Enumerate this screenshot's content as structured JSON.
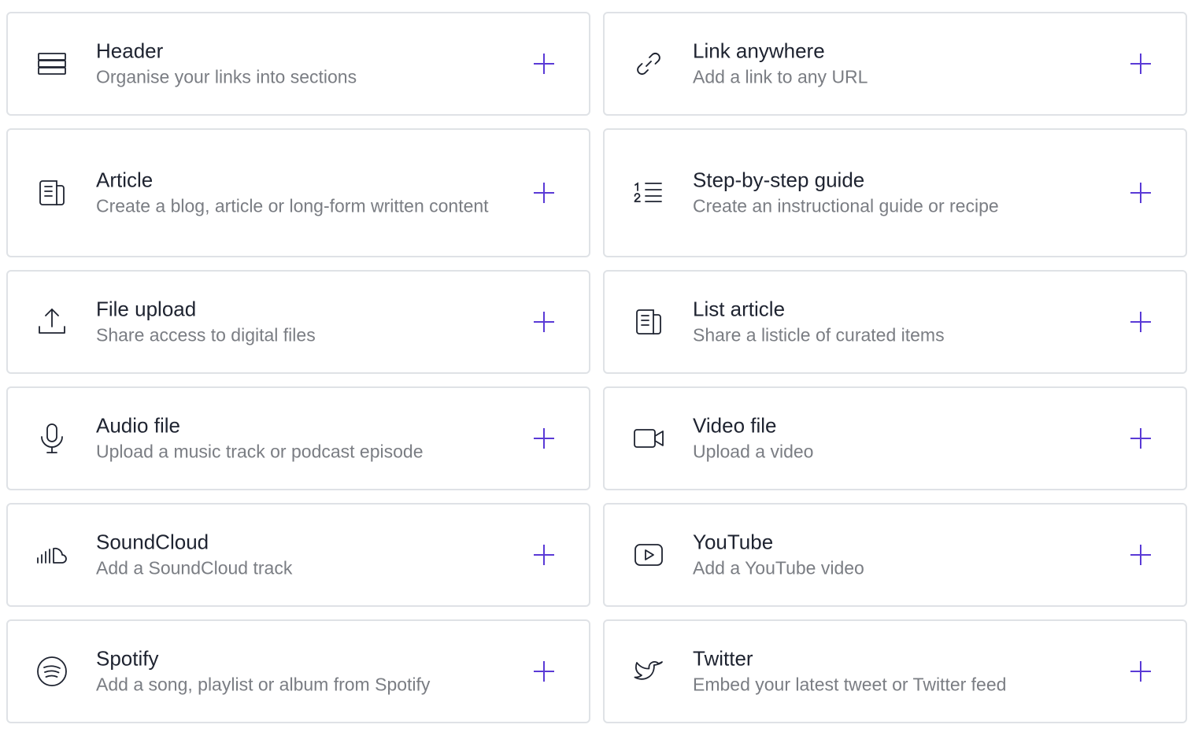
{
  "accent_color": "#5a3ad6",
  "icon_color": "#1e2330",
  "blocks": [
    {
      "title": "Header",
      "description": "Organise your links into sections",
      "icon": "header-icon"
    },
    {
      "title": "Link anywhere",
      "description": "Add a link to any URL",
      "icon": "link-icon"
    },
    {
      "title": "Article",
      "description": "Create a blog, article or long-form written content",
      "icon": "article-icon"
    },
    {
      "title": "Step-by-step guide",
      "description": "Create an instructional guide or recipe",
      "icon": "numbered-list-icon"
    },
    {
      "title": "File upload",
      "description": "Share access to digital files",
      "icon": "upload-icon"
    },
    {
      "title": "List article",
      "description": "Share a listicle of curated items",
      "icon": "list-article-icon"
    },
    {
      "title": "Audio file",
      "description": "Upload a music track or podcast episode",
      "icon": "microphone-icon"
    },
    {
      "title": "Video file",
      "description": "Upload a video",
      "icon": "video-camera-icon"
    },
    {
      "title": "SoundCloud",
      "description": "Add a SoundCloud track",
      "icon": "soundcloud-icon"
    },
    {
      "title": "YouTube",
      "description": "Add a YouTube video",
      "icon": "youtube-icon"
    },
    {
      "title": "Spotify",
      "description": "Add a song, playlist or album from Spotify",
      "icon": "spotify-icon"
    },
    {
      "title": "Twitter",
      "description": "Embed your latest tweet or Twitter feed",
      "icon": "twitter-icon"
    }
  ]
}
